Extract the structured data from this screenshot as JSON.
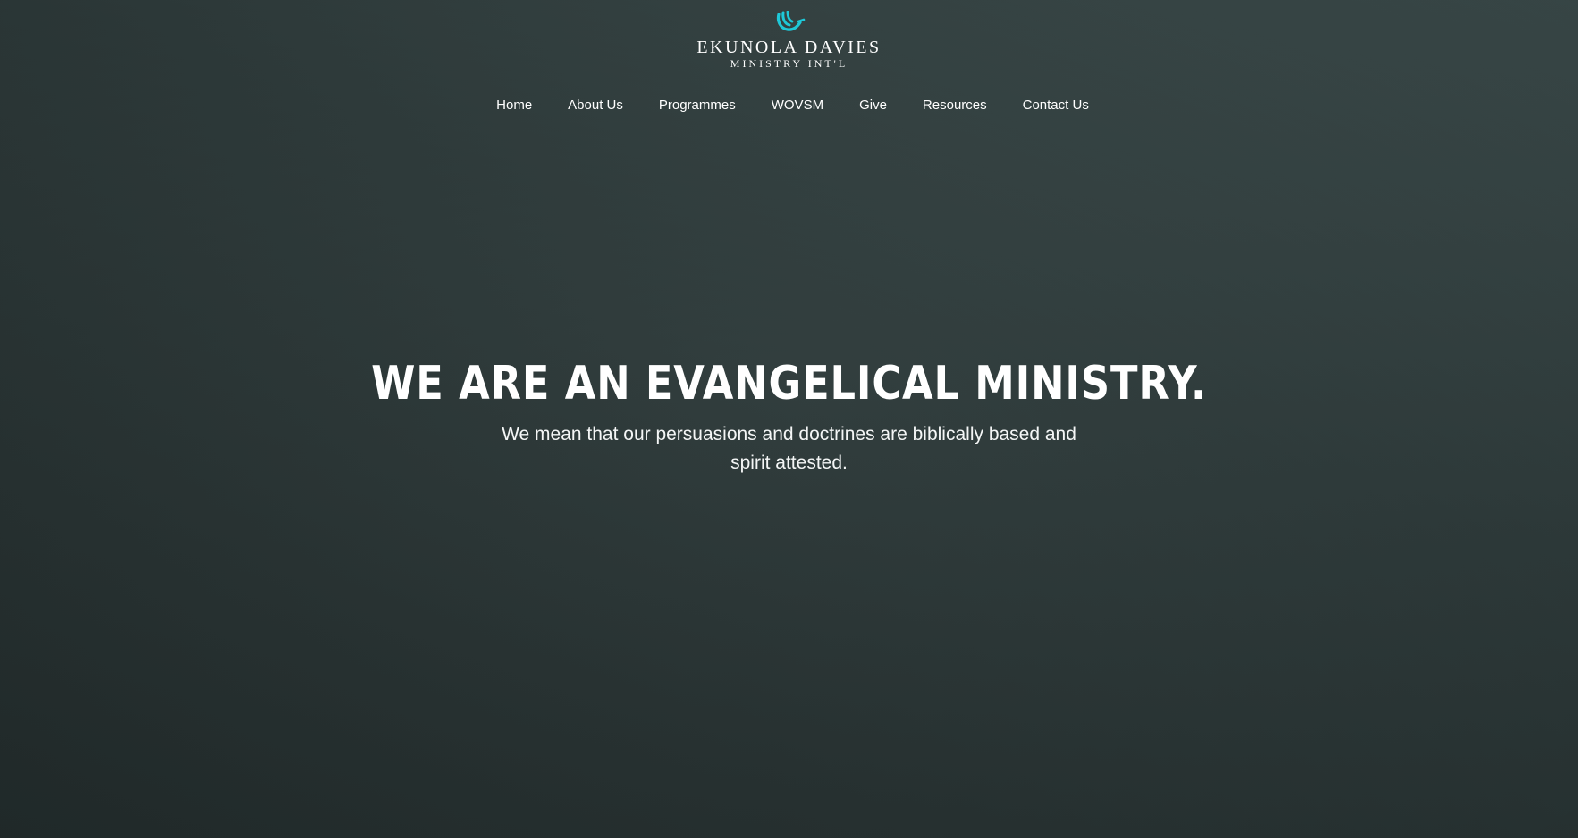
{
  "brand": {
    "name": "Ekunola Davies",
    "subtitle": "Ministry Int'l",
    "logo_icon": "hands-icon",
    "accent_color": "#1ec8d8"
  },
  "nav": {
    "items": [
      {
        "label": "Home"
      },
      {
        "label": "About Us"
      },
      {
        "label": "Programmes"
      },
      {
        "label": "WOVSM"
      },
      {
        "label": "Give"
      },
      {
        "label": "Resources"
      },
      {
        "label": "Contact Us"
      }
    ]
  },
  "hero": {
    "title": "WE ARE AN EVANGELICAL MINISTRY.",
    "subtitle": "We mean that our persuasions and doctrines are biblically based and spirit attested."
  },
  "colors": {
    "background": "#2f3c3c",
    "text": "#ffffff"
  }
}
